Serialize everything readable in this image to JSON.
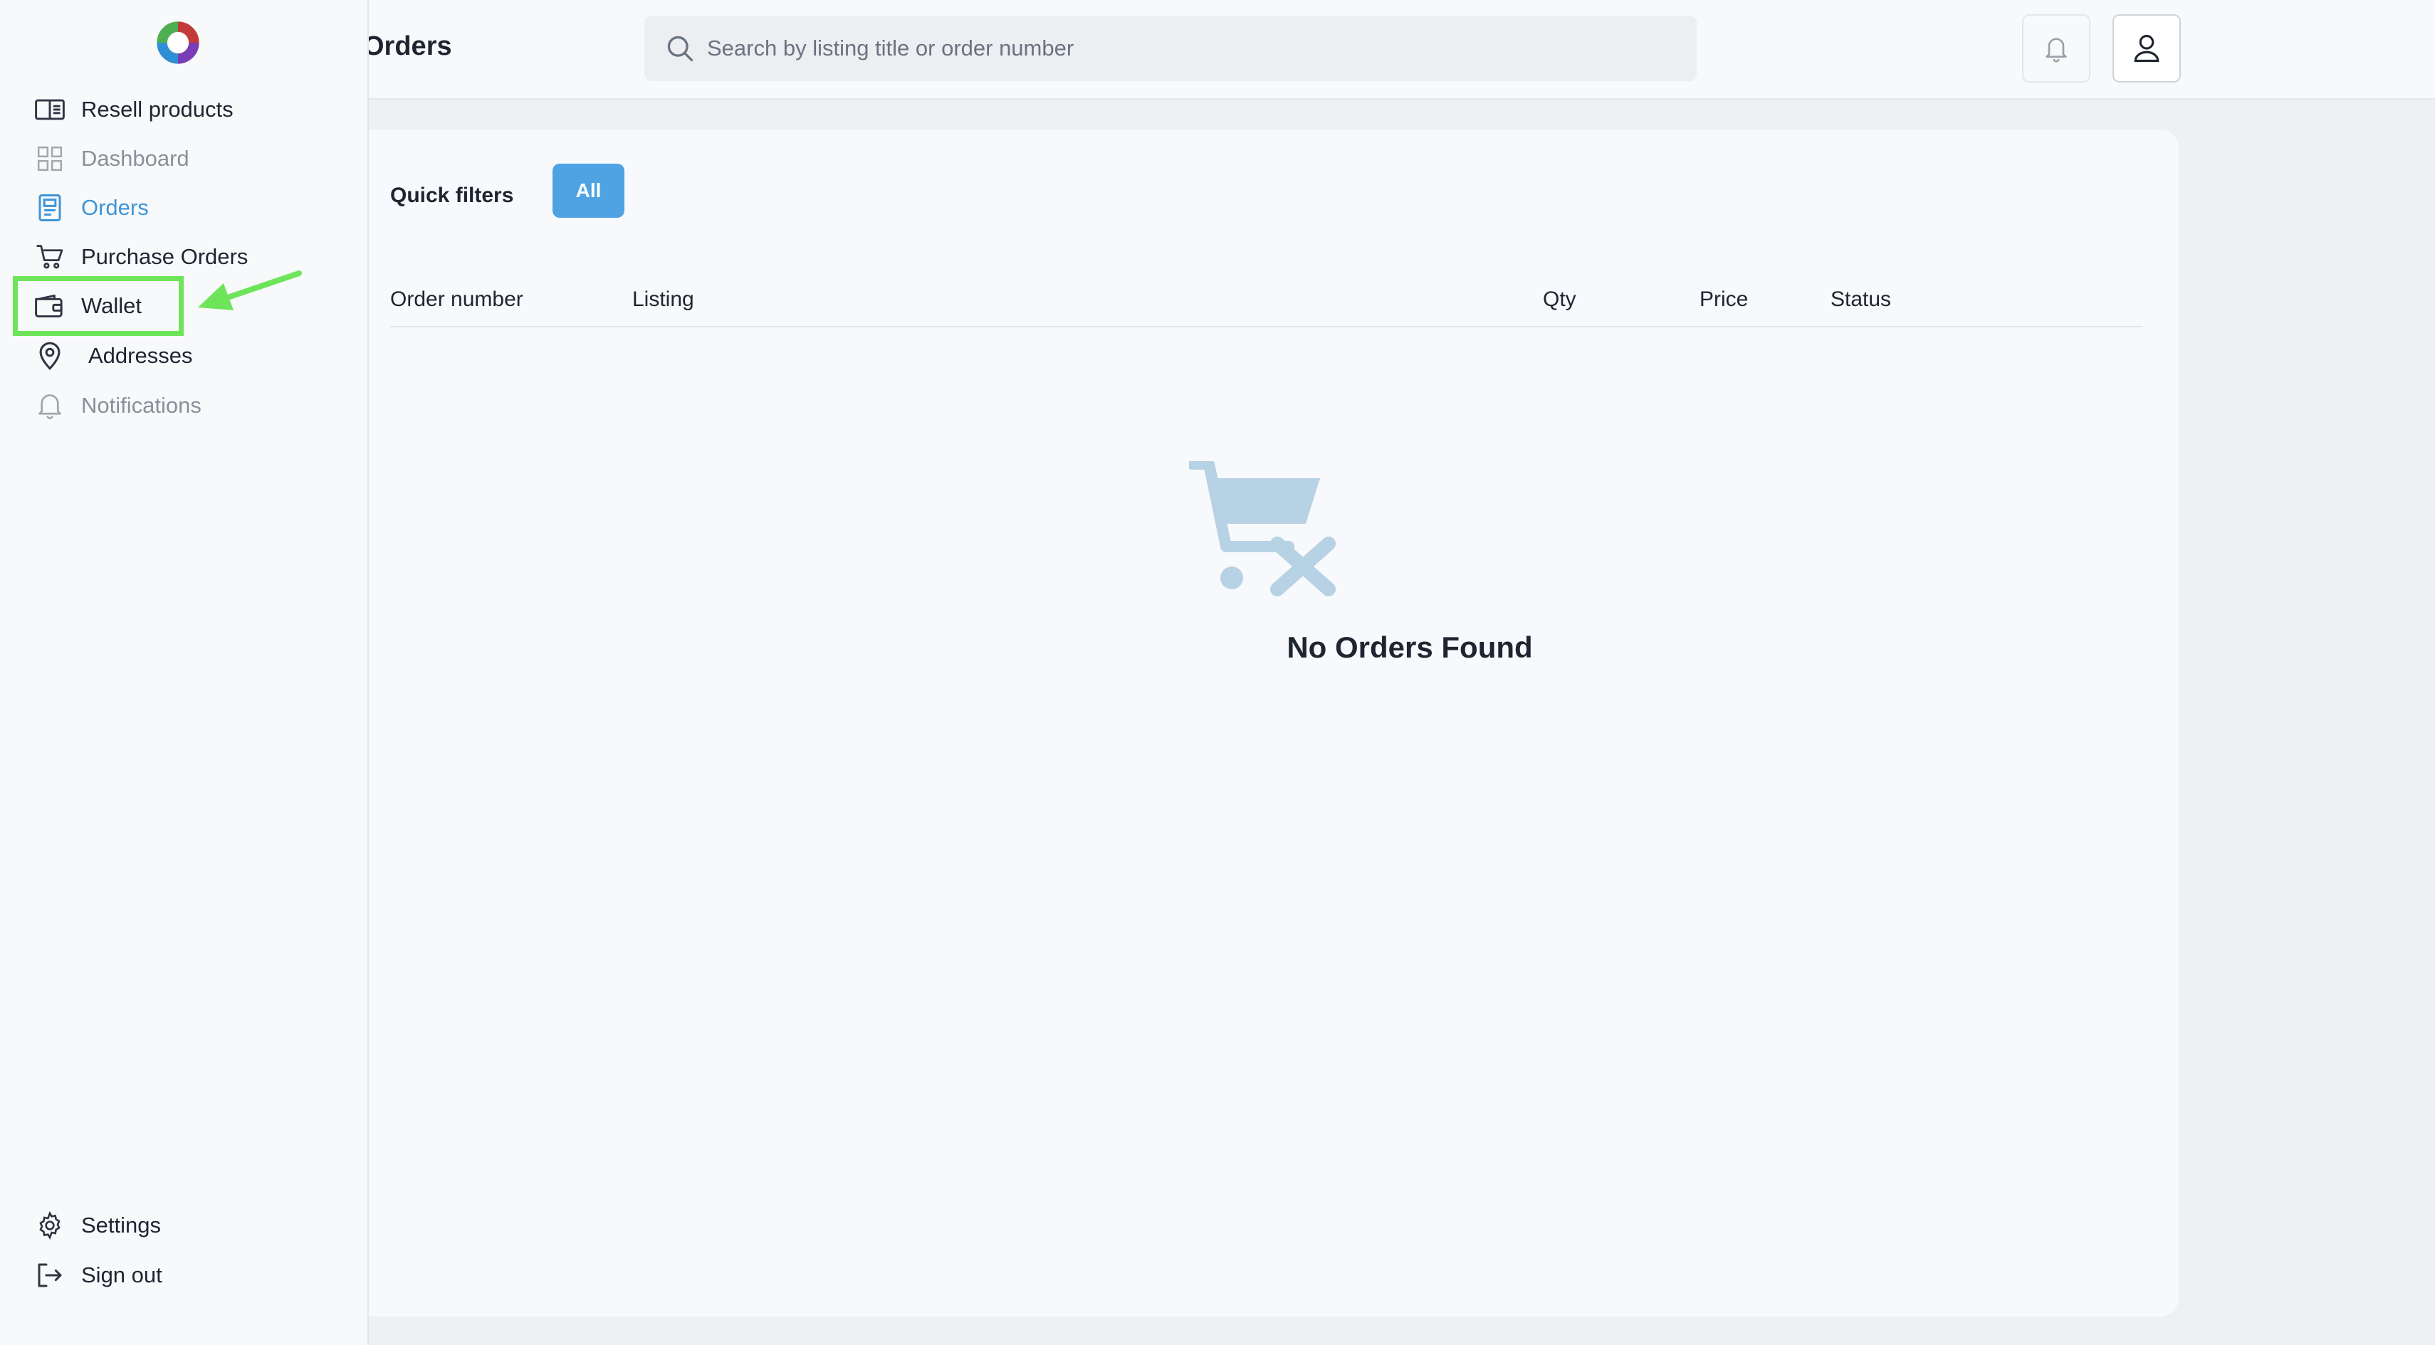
{
  "header": {
    "title": "Orders",
    "search_placeholder": "Search by listing title or order number"
  },
  "sidebar": {
    "items": [
      {
        "label": "Resell products",
        "icon": "catalog-icon",
        "state": "normal"
      },
      {
        "label": "Dashboard",
        "icon": "grid-icon",
        "state": "muted"
      },
      {
        "label": "Orders",
        "icon": "order-doc-icon",
        "state": "active"
      },
      {
        "label": "Purchase Orders",
        "icon": "cart-icon",
        "state": "normal"
      },
      {
        "label": "Wallet",
        "icon": "wallet-icon",
        "state": "normal"
      },
      {
        "label": "Addresses",
        "icon": "location-pin-icon",
        "state": "normal"
      },
      {
        "label": "Notifications",
        "icon": "bell-icon",
        "state": "muted"
      }
    ],
    "bottom_items": [
      {
        "label": "Settings",
        "icon": "gear-icon"
      },
      {
        "label": "Sign out",
        "icon": "sign-out-icon"
      }
    ]
  },
  "filters": {
    "label": "Quick filters",
    "chips": [
      {
        "label": "All",
        "active": true
      }
    ]
  },
  "table": {
    "columns": [
      "Order number",
      "Listing",
      "Qty",
      "Price",
      "Status"
    ],
    "rows": []
  },
  "empty_state": {
    "message": "No Orders Found",
    "icon": "empty-cart-icon"
  },
  "colors": {
    "accent": "#4fa3e3",
    "active_nav": "#3e95d8",
    "annotation": "#6ee45a"
  }
}
